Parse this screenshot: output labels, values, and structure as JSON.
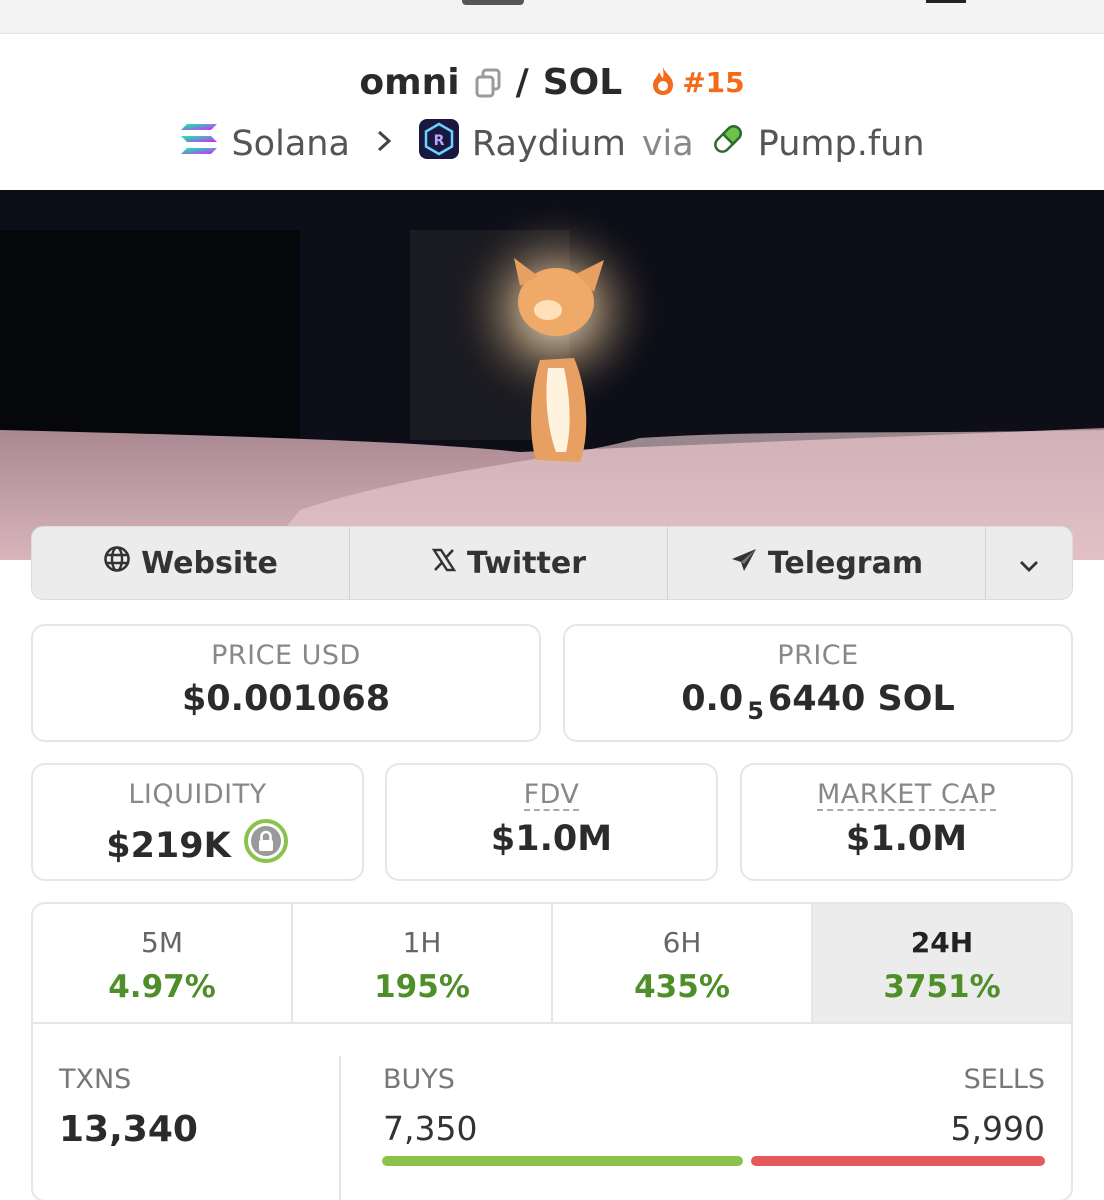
{
  "header": {
    "token": "omni",
    "separator": "/",
    "quote": "SOL",
    "trending_rank": "#15",
    "chain": "Solana",
    "dex": "Raydium",
    "via": "via",
    "launchpad": "Pump.fun",
    "icons": [
      "copy-icon",
      "flame-icon",
      "solana-logo-icon",
      "chevron-right-icon",
      "raydium-logo-icon",
      "pill-icon"
    ]
  },
  "banner": {
    "description_hidden": true
  },
  "socials": [
    {
      "label": "Website",
      "icon": "globe-icon"
    },
    {
      "label": "Twitter",
      "icon": "x-logo-icon"
    },
    {
      "label": "Telegram",
      "icon": "paper-plane-icon"
    }
  ],
  "stats": {
    "price_usd": {
      "label": "PRICE USD",
      "value": "$0.001068"
    },
    "price": {
      "label": "PRICE",
      "value_prefix": "0.0",
      "value_sub": "5",
      "value_suffix": "6440 SOL"
    },
    "liquidity": {
      "label": "LIQUIDITY",
      "value": "$219K",
      "icon": "lock-icon"
    },
    "fdv": {
      "label": "FDV",
      "value": "$1.0M"
    },
    "market_cap": {
      "label": "MARKET CAP",
      "value": "$1.0M"
    }
  },
  "changes": [
    {
      "label": "5M",
      "value": "4.97%"
    },
    {
      "label": "1H",
      "value": "195%"
    },
    {
      "label": "6H",
      "value": "435%"
    },
    {
      "label": "24H",
      "value": "3751%"
    }
  ],
  "transactions": {
    "txns_label": "TXNS",
    "txns": "13,340",
    "buys_label": "BUYS",
    "buys": "7,350",
    "sells_label": "SELLS",
    "sells": "5,990",
    "buy_ratio": 0.551
  },
  "colors": {
    "positive": "#4e8f2a",
    "trend": "#f26a1a",
    "buy_bar": "#8bc34a",
    "sell_bar": "#e45a5a"
  }
}
